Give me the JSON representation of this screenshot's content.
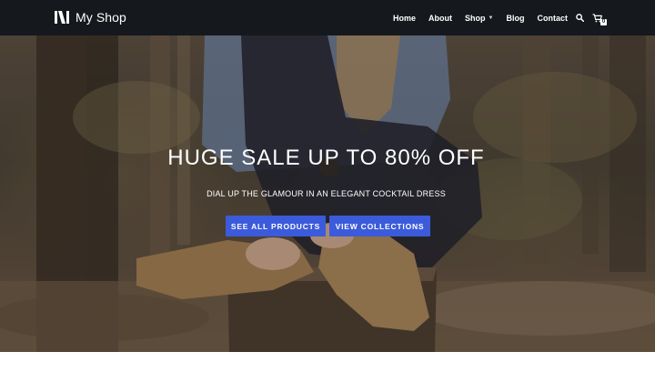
{
  "header": {
    "brand_name": "My Shop",
    "logo_icon": "shop-logo-icon",
    "background": "#15181d",
    "nav": [
      {
        "label": "Home"
      },
      {
        "label": "About"
      },
      {
        "label": "Shop",
        "has_dropdown": true
      },
      {
        "label": "Blog"
      },
      {
        "label": "Contact"
      }
    ],
    "search_icon": "search-icon",
    "cart_icon": "cart-icon",
    "cart_count": "0"
  },
  "hero": {
    "title": "HUGE SALE UP TO 80% OFF",
    "subtitle": "DIAL UP THE GLAMOUR IN AN ELEGANT COCKTAIL DRESS",
    "buttons": [
      {
        "label": "SEE ALL PRODUCTS"
      },
      {
        "label": "VIEW COLLECTIONS"
      }
    ],
    "button_color": "#3b5bdb"
  }
}
